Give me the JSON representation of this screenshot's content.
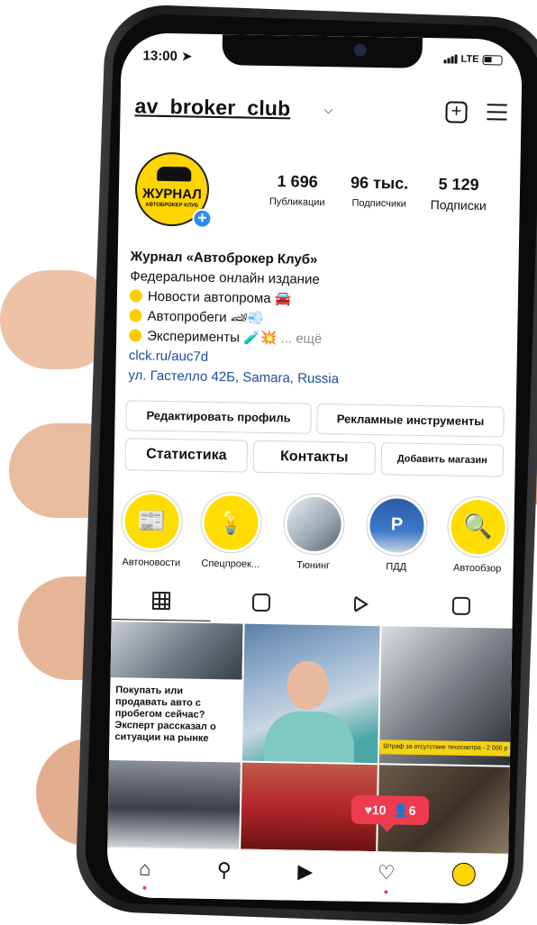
{
  "status_bar": {
    "time": "13:00",
    "network": "LTE"
  },
  "header": {
    "username": "av_broker_club"
  },
  "profile": {
    "avatar_text": "ЖУРНАЛ",
    "avatar_subtext": "АВТОБРОКЕР КЛУБ",
    "stats": [
      {
        "value": "1 696",
        "label": "Публикации"
      },
      {
        "value": "96 тыс.",
        "label": "Подписчики"
      },
      {
        "value": "5 129",
        "label": "Подписки"
      }
    ],
    "bio": {
      "name": "Журнал «Автоброкер Клуб»",
      "subtitle": "Федеральное онлайн издание",
      "line1": "Новости автопрома 🚘",
      "line2": "Автопробеги 🏎💨",
      "line3": "Эксперименты 🧪💥",
      "more": "... ещё",
      "link": "clck.ru/auc7d",
      "address": "ул. Гастелло 42Б, Samara, Russia"
    }
  },
  "buttons": {
    "edit_profile": "Редактировать профиль",
    "ad_tools": "Рекламные инструменты",
    "stats": "Статистика",
    "contacts": "Контакты",
    "add_shop": "Добавить магазин"
  },
  "highlights": [
    {
      "label": "Автоновости",
      "icon": "newspaper-icon"
    },
    {
      "label": "Спецпроек...",
      "icon": "lightbulb-icon"
    },
    {
      "label": "Тюнинг",
      "icon": "car-photo"
    },
    {
      "label": "ПДД",
      "icon": "parking-photo"
    },
    {
      "label": "Автообзор",
      "icon": "car-magnifier-icon"
    }
  ],
  "post_caption": "Покупать или продавать авто с пробегом сейчас? Эксперт рассказал о ситуации на рынке",
  "post_strip": "Штраф за отсутствие техосмотра - 2 000 р",
  "notifications": {
    "likes": "10",
    "followers": "6"
  },
  "colors": {
    "accent": "#ffd400",
    "badge": "#ef3b4f",
    "link": "#1d4fa3"
  }
}
